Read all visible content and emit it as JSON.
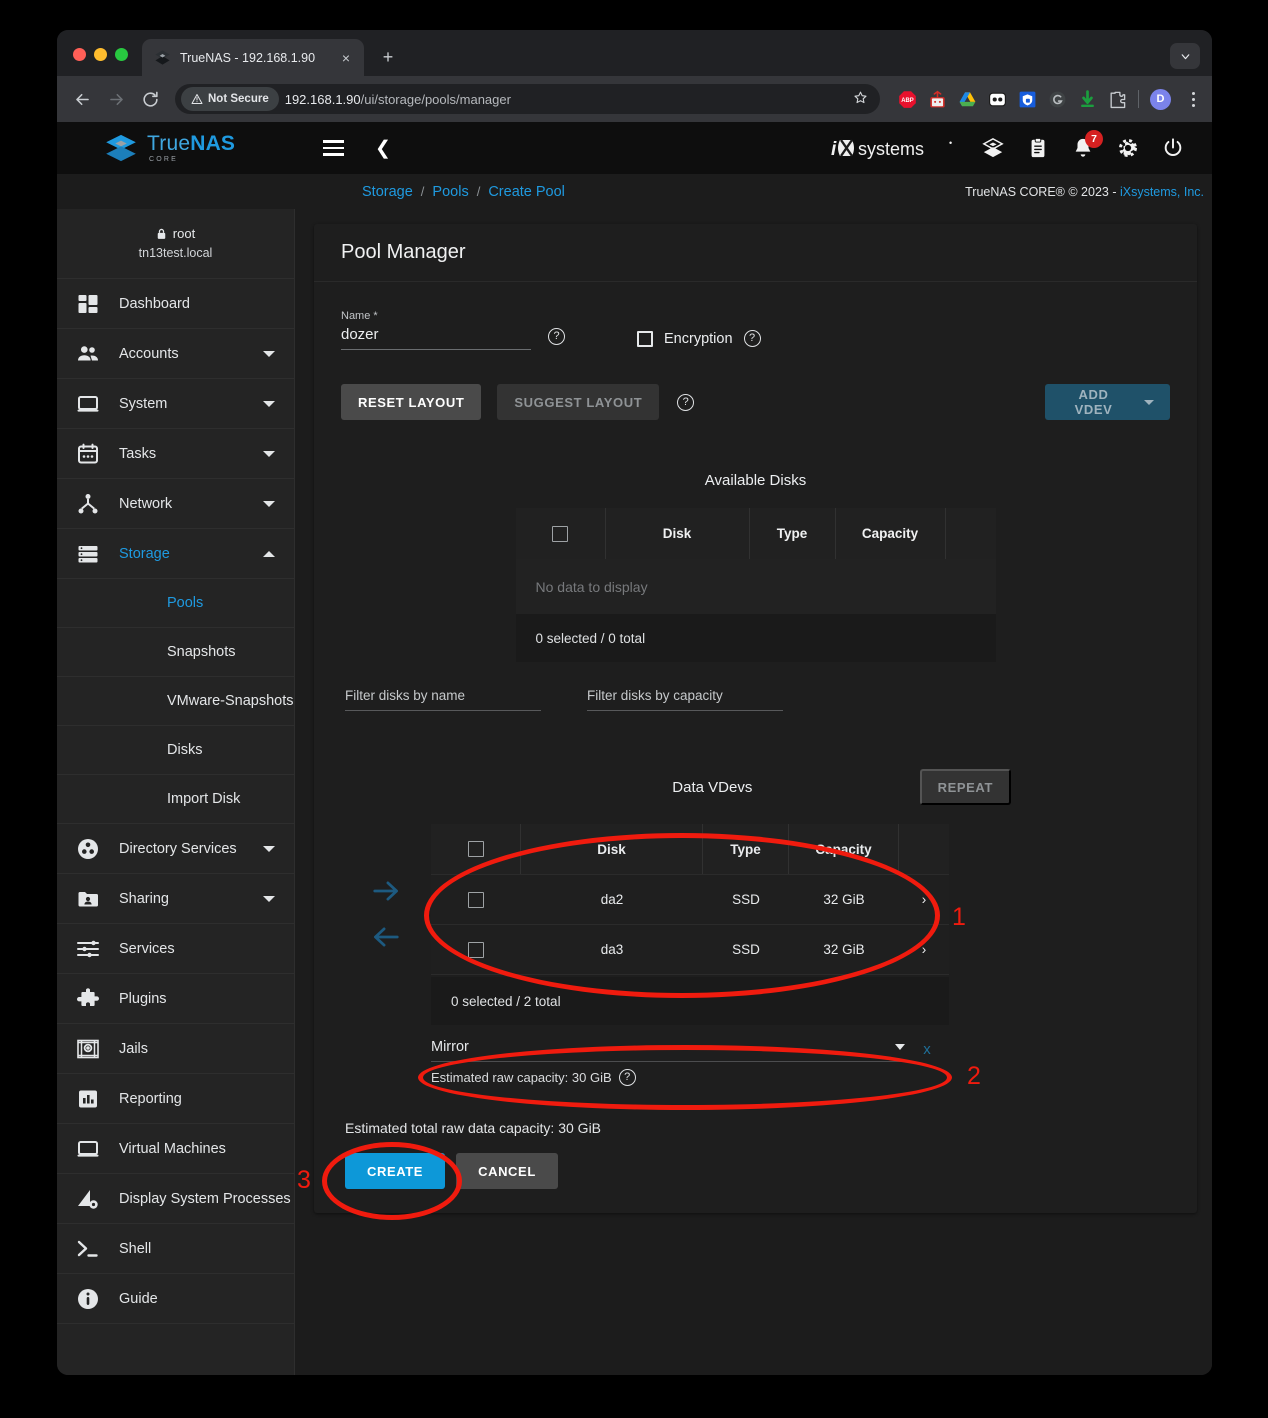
{
  "browser": {
    "tab": {
      "title": "TrueNAS - 192.168.1.90",
      "favicon_name": "truenas-favicon",
      "close_label": "×"
    },
    "newtab_label": "+",
    "tabstrip_menu_icon": "chevron-down-icon",
    "toolbar": {
      "back_label": "←",
      "forward_label": "→",
      "reload_label": "⟳",
      "security_label": "Not Secure",
      "url_host": "192.168.1.90",
      "url_path": "/ui/storage/pools/manager",
      "bookmark_icon": "star-icon",
      "extensions": [
        "adblock-plus-icon",
        "lastpass-icon",
        "google-drive-icon",
        "pocket-casts-icon",
        "bitwarden-icon",
        "grammarly-icon",
        "download-icon",
        "extensions-puzzle-icon"
      ],
      "profile_initial": "D",
      "menu_icon": "kebab-menu-icon"
    }
  },
  "app": {
    "brand": {
      "name_part1": "True",
      "name_part2": "NAS",
      "subtitle": "CORE",
      "logo_icon": "truenas-logo-icon"
    },
    "hamburger_icon": "hamburger-menu-icon",
    "collapse_icon": "chevron-left-icon",
    "vendor_logo": "ixsystems-logo",
    "header_icons": [
      {
        "name": "tasks-manager-icon"
      },
      {
        "name": "jobs-clipboard-icon"
      },
      {
        "name": "alerts-bell-icon",
        "badge": "7"
      },
      {
        "name": "settings-gear-icon"
      },
      {
        "name": "power-icon"
      }
    ],
    "breadcrumb": [
      {
        "label": "Storage"
      },
      {
        "label": "Pools"
      },
      {
        "label": "Create Pool"
      }
    ],
    "breadcrumb_separator": "/",
    "copyright_text": "TrueNAS CORE® © 2023 - ",
    "copyright_link": "iXsystems, Inc."
  },
  "sidebar": {
    "user": "root",
    "hostname": "tn13test.local",
    "lock_icon": "lock-icon",
    "items": [
      {
        "label": "Dashboard",
        "icon": "dashboard-icon",
        "expandable": false,
        "active": false
      },
      {
        "label": "Accounts",
        "icon": "accounts-people-icon",
        "expandable": true,
        "active": false
      },
      {
        "label": "System",
        "icon": "system-laptop-icon",
        "expandable": true,
        "active": false
      },
      {
        "label": "Tasks",
        "icon": "tasks-calendar-icon",
        "expandable": true,
        "active": false
      },
      {
        "label": "Network",
        "icon": "network-icon",
        "expandable": true,
        "active": false
      },
      {
        "label": "Storage",
        "icon": "storage-icon",
        "expandable": true,
        "active": true,
        "expanded": true
      }
    ],
    "storage_subitems": [
      {
        "label": "Pools",
        "active": true
      },
      {
        "label": "Snapshots",
        "active": false
      },
      {
        "label": "VMware-Snapshots",
        "active": false
      },
      {
        "label": "Disks",
        "active": false
      },
      {
        "label": "Import Disk",
        "active": false
      }
    ],
    "items_lower": [
      {
        "label": "Directory Services",
        "icon": "directory-services-icon",
        "expandable": true
      },
      {
        "label": "Sharing",
        "icon": "sharing-folder-icon",
        "expandable": true
      },
      {
        "label": "Services",
        "icon": "services-sliders-icon",
        "expandable": false
      },
      {
        "label": "Plugins",
        "icon": "plugins-puzzle-icon",
        "expandable": false
      },
      {
        "label": "Jails",
        "icon": "jails-icon",
        "expandable": false
      },
      {
        "label": "Reporting",
        "icon": "reporting-chart-icon",
        "expandable": false
      },
      {
        "label": "Virtual Machines",
        "icon": "virtual-machines-icon",
        "expandable": false
      },
      {
        "label": "Display System Processes",
        "icon": "system-processes-icon",
        "expandable": false
      },
      {
        "label": "Shell",
        "icon": "shell-prompt-icon",
        "expandable": false
      },
      {
        "label": "Guide",
        "icon": "guide-info-icon",
        "expandable": false
      }
    ]
  },
  "pool_manager": {
    "title": "Pool Manager",
    "name_field": {
      "label": "Name *",
      "value": "dozer",
      "placeholder": ""
    },
    "encryption": {
      "label": "Encryption",
      "checked": false
    },
    "buttons": {
      "reset_layout": "RESET LAYOUT",
      "suggest_layout": "SUGGEST LAYOUT",
      "add_vdev": "ADD VDEV",
      "repeat": "REPEAT",
      "create": "CREATE",
      "cancel": "CANCEL"
    },
    "available_disks": {
      "title": "Available Disks",
      "columns": [
        "Disk",
        "Type",
        "Capacity"
      ],
      "empty_text": "No data to display",
      "footer": "0 selected / 0 total"
    },
    "filters": {
      "by_name": "Filter disks by name",
      "by_capacity": "Filter disks by capacity"
    },
    "data_vdevs": {
      "title": "Data VDevs",
      "columns": [
        "Disk",
        "Type",
        "Capacity"
      ],
      "rows": [
        {
          "disk": "da2",
          "type": "SSD",
          "capacity": "32 GiB"
        },
        {
          "disk": "da3",
          "type": "SSD",
          "capacity": "32 GiB"
        }
      ],
      "footer": "0 selected / 2 total",
      "layout_value": "Mirror",
      "remove_label": "x",
      "estimated_raw_capacity": "Estimated raw capacity: 30 GiB"
    },
    "estimated_total": "Estimated total raw data capacity: 30 GiB",
    "arrows": {
      "right": "arrow-right-icon",
      "left": "arrow-left-icon"
    }
  },
  "annotations": {
    "color": "#f01b0e",
    "markers": [
      {
        "number": "1"
      },
      {
        "number": "2"
      },
      {
        "number": "3"
      }
    ]
  }
}
